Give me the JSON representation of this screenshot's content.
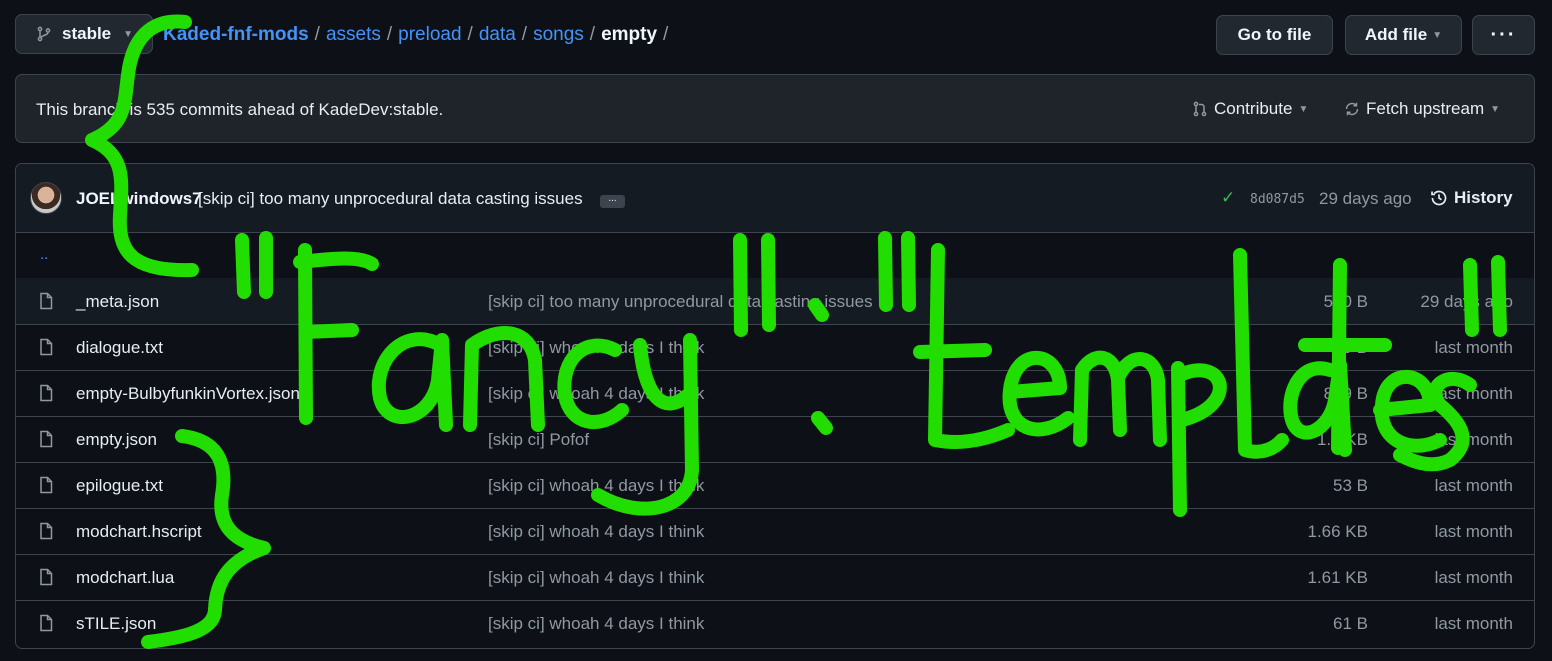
{
  "branch": {
    "name": "stable"
  },
  "breadcrumb": {
    "repo": "Kaded-fnf-mods",
    "parts": [
      "assets",
      "preload",
      "data",
      "songs"
    ],
    "current": "empty",
    "separator": "/"
  },
  "toolbar": {
    "go_to_file": "Go to file",
    "add_file": "Add file",
    "more": "···"
  },
  "branch_status": {
    "text": "This branch is 535 commits ahead of KadeDev:stable.",
    "contribute": "Contribute",
    "fetch_upstream": "Fetch upstream"
  },
  "latest_commit": {
    "author": "JOELwindows7",
    "message": "[skip ci] too many unprocedural data casting issues",
    "ellipsis": "...",
    "sha": "8d087d5",
    "age": "29 days ago",
    "history": "History"
  },
  "parent_link": "..",
  "files": [
    {
      "name": "_meta.json",
      "message": "[skip ci] too many unprocedural data casting issues",
      "size": "500 B",
      "date": "29 days ago"
    },
    {
      "name": "dialogue.txt",
      "message": "[skip ci] whoah 4 days I think",
      "size": "0 B",
      "date": "last month"
    },
    {
      "name": "empty-BulbyfunkinVortex.json",
      "message": "[skip ci] whoah 4 days I think",
      "size": "859 B",
      "date": "last month"
    },
    {
      "name": "empty.json",
      "message": "[skip ci] Pofof",
      "size": "1.5 KB",
      "date": "last month"
    },
    {
      "name": "epilogue.txt",
      "message": "[skip ci] whoah 4 days I think",
      "size": "53 B",
      "date": "last month"
    },
    {
      "name": "modchart.hscript",
      "message": "[skip ci] whoah 4 days I think",
      "size": "1.66 KB",
      "date": "last month"
    },
    {
      "name": "modchart.lua",
      "message": "[skip ci] whoah 4 days I think",
      "size": "1.61 KB",
      "date": "last month"
    },
    {
      "name": "sTILE.json",
      "message": "[skip ci] whoah 4 days I think",
      "size": "61 B",
      "date": "last month"
    }
  ],
  "annotation": {
    "text": "\"Fancy\" : \"templates\"",
    "color": "#22dd00"
  },
  "colors": {
    "link": "#4493f8",
    "success": "#3fb950",
    "background": "#0d1117"
  }
}
